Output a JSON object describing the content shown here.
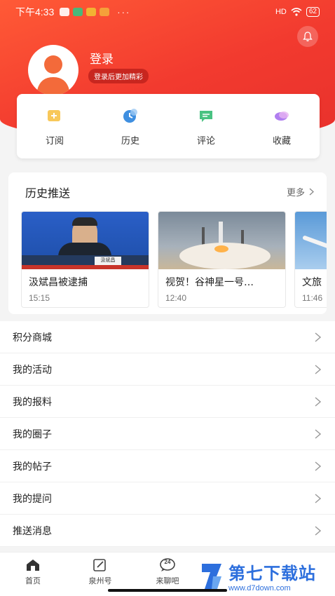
{
  "status": {
    "time": "下午4:33",
    "dots": "···",
    "signal": "HD",
    "battery": "62"
  },
  "profile": {
    "title": "登录",
    "subtitle": "登录后更加精彩"
  },
  "quick": [
    {
      "label": "订阅",
      "icon": "subscribe-icon"
    },
    {
      "label": "历史",
      "icon": "history-icon"
    },
    {
      "label": "评论",
      "icon": "comment-icon"
    },
    {
      "label": "收藏",
      "icon": "favorite-icon"
    }
  ],
  "history": {
    "title": "历史推送",
    "more": "更多",
    "cards": [
      {
        "title": "汲斌昌被逮捕",
        "time": "15:15",
        "nameplate": "汲斌昌"
      },
      {
        "title": "视贺！谷神星一号…",
        "time": "12:40"
      },
      {
        "title": "文旅",
        "time": "11:46"
      }
    ]
  },
  "menu": [
    "积分商城",
    "我的活动",
    "我的报料",
    "我的圈子",
    "我的帖子",
    "我的提问"
  ],
  "menu2": [
    "推送消息"
  ],
  "tabs": [
    {
      "label": "首页",
      "icon": "home-icon"
    },
    {
      "label": "泉州号",
      "icon": "edit-icon"
    },
    {
      "label": "来聊吧",
      "icon": "chat-icon",
      "badge": "24"
    }
  ],
  "watermark": {
    "title": "第七下载站",
    "url": "www.d7down.com"
  },
  "colors": {
    "brand": "#f23a2f",
    "text": "#222222",
    "watermark": "#2d6fdd"
  }
}
